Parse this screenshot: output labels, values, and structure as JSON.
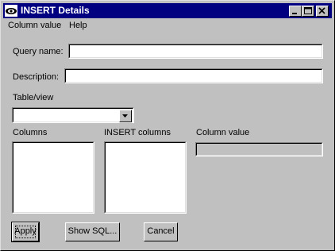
{
  "window": {
    "title": "INSERT Details"
  },
  "menubar": {
    "items": [
      {
        "label": "Column value",
        "mnemonic": "C"
      },
      {
        "label": "Help",
        "mnemonic": "H"
      }
    ]
  },
  "form": {
    "query_name_label": "Query name:",
    "query_name_value": "",
    "description_label": "Description:",
    "description_value": "",
    "table_view_label": "Table/view",
    "table_view_value": "",
    "columns_label": "Columns",
    "insert_columns_label": "INSERT columns",
    "column_value_label": "Column value",
    "column_value_value": ""
  },
  "buttons": {
    "apply": "Apply",
    "show_sql": "Show SQL...",
    "cancel": "Cancel"
  }
}
